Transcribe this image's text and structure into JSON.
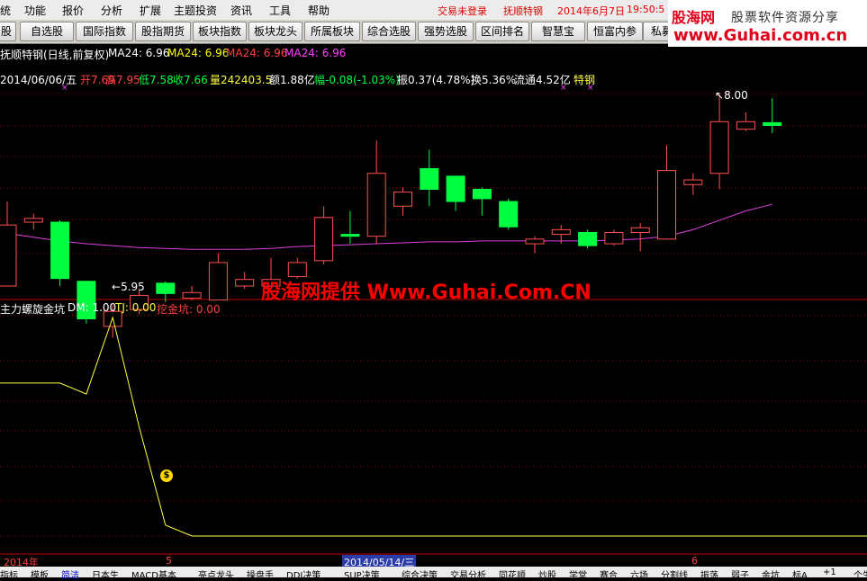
{
  "menu": [
    "统",
    "功能",
    "报价",
    "分析",
    "扩展",
    "主题投资",
    "资讯",
    "工具",
    "帮助"
  ],
  "status": {
    "login": "交易未登录",
    "stock": "抚顺特钢",
    "date": "2014年6月7日",
    "time": "19:50:5"
  },
  "logo": {
    "brand": "股海网",
    "slogan": "股票软件资源分享",
    "url": "www.Guhai.com.cn"
  },
  "toolbar": [
    "股",
    "自选股",
    "国际指数",
    "股指期货",
    "板块指数",
    "板块龙头",
    "所属板块",
    "综合选股",
    "强势选股",
    "区间排名",
    "智慧宝",
    "恒富内参",
    "私募"
  ],
  "chart_header": {
    "title": "抚顺特钢(日线,前复权)",
    "ma_items": [
      {
        "label": "MA24: 6.96",
        "color": "#ffffff"
      },
      {
        "label": "MA24: 6.96",
        "color": "#ffff00"
      },
      {
        "label": "MA24: 6.96",
        "color": "#ff4040"
      },
      {
        "label": "MA24: 6.96",
        "color": "#ff40ff"
      }
    ]
  },
  "info_line": {
    "date": "2014/06/06/五",
    "open": "开7.69",
    "high": "高7.95",
    "low": "低7.58",
    "close": "收7.66",
    "volume": "量242403.5",
    "amount": "额1.88亿",
    "change": "幅-0.08(-1.03%)",
    "amplitude": "振0.37(4.78%)",
    "turnover": "换5.36%",
    "float": "流通4.52亿",
    "sector": "特钢"
  },
  "annotations": {
    "high": "8.00",
    "low": "5.95"
  },
  "watermark": "股海网提供 Www.Guhai.Com.CN",
  "indicator": {
    "name": "主力螺旋金坑",
    "dm": "DM: 1.00",
    "tj": "TJ: 0.00",
    "wjk": "挖金坑: 0.00",
    "marker": "$"
  },
  "time_axis": {
    "start": "2014年",
    "mid": "5",
    "cursor": "2014/05/14/三",
    "end": "6"
  },
  "bottom_tabs": [
    "指标",
    "模板",
    "简洁",
    "日本生",
    "MACD基本",
    "亮点龙头",
    "操盘手",
    "DDI决策",
    "SUP决策",
    "综合决策",
    "交易分析",
    "同花顺",
    "炒股",
    "学堂",
    "赛合",
    "六场",
    "分割线",
    "振荡",
    "弱子",
    "金坑",
    "标A",
    "+1",
    "个生"
  ],
  "colors": {
    "up": "#ff5050",
    "down": "#00ff40",
    "ma": "#e040e0",
    "indicator": "#ffff40",
    "grid": "#8b0000"
  },
  "chart_data": {
    "type": "candlestick",
    "candles": [
      {
        "o": 5.95,
        "c": 6.6,
        "h": 6.85,
        "l": 5.95
      },
      {
        "o": 6.63,
        "c": 6.67,
        "h": 6.72,
        "l": 6.55
      },
      {
        "o": 6.63,
        "c": 6.03,
        "h": 6.65,
        "l": 5.95
      },
      {
        "o": 6.0,
        "c": 5.6,
        "h": 6.0,
        "l": 5.55
      },
      {
        "o": 5.52,
        "c": 5.68,
        "h": 5.75,
        "l": 5.4
      },
      {
        "o": 5.7,
        "c": 5.85,
        "h": 5.9,
        "l": 5.65
      },
      {
        "o": 5.98,
        "c": 5.87,
        "h": 6.0,
        "l": 5.78
      },
      {
        "o": 5.82,
        "c": 5.88,
        "h": 5.95,
        "l": 5.8
      },
      {
        "o": 5.8,
        "c": 6.2,
        "h": 6.3,
        "l": 5.8
      },
      {
        "o": 5.95,
        "c": 6.02,
        "h": 6.1,
        "l": 5.92
      },
      {
        "o": 5.95,
        "c": 6.02,
        "h": 6.25,
        "l": 5.92
      },
      {
        "o": 6.05,
        "c": 6.2,
        "h": 6.25,
        "l": 6.03
      },
      {
        "o": 6.22,
        "c": 6.68,
        "h": 6.8,
        "l": 6.18
      },
      {
        "o": 6.5,
        "c": 6.48,
        "h": 6.75,
        "l": 6.4
      },
      {
        "o": 6.48,
        "c": 7.15,
        "h": 7.5,
        "l": 6.4
      },
      {
        "o": 6.8,
        "c": 6.95,
        "h": 7.0,
        "l": 6.7
      },
      {
        "o": 7.2,
        "c": 6.98,
        "h": 7.4,
        "l": 6.8
      },
      {
        "o": 7.12,
        "c": 6.85,
        "h": 7.12,
        "l": 6.75
      },
      {
        "o": 6.98,
        "c": 6.88,
        "h": 7.0,
        "l": 6.7
      },
      {
        "o": 6.85,
        "c": 6.58,
        "h": 6.88,
        "l": 6.55
      },
      {
        "o": 6.4,
        "c": 6.45,
        "h": 6.48,
        "l": 6.3
      },
      {
        "o": 6.5,
        "c": 6.55,
        "h": 6.6,
        "l": 6.4
      },
      {
        "o": 6.52,
        "c": 6.38,
        "h": 6.55,
        "l": 6.35
      },
      {
        "o": 6.4,
        "c": 6.52,
        "h": 6.55,
        "l": 6.38
      },
      {
        "o": 6.52,
        "c": 6.57,
        "h": 6.62,
        "l": 6.32
      },
      {
        "o": 6.45,
        "c": 7.18,
        "h": 7.45,
        "l": 6.45
      },
      {
        "o": 7.03,
        "c": 7.08,
        "h": 7.15,
        "l": 6.92
      },
      {
        "o": 7.15,
        "c": 7.7,
        "h": 8.0,
        "l": 6.98
      },
      {
        "o": 7.62,
        "c": 7.7,
        "h": 7.8,
        "l": 7.6
      },
      {
        "o": 7.69,
        "c": 7.66,
        "h": 7.95,
        "l": 7.58
      }
    ],
    "ma": [
      6.51,
      6.47,
      6.43,
      6.4,
      6.38,
      6.36,
      6.35,
      6.34,
      6.34,
      6.34,
      6.35,
      6.37,
      6.38,
      6.39,
      6.4,
      6.41,
      6.42,
      6.42,
      6.43,
      6.43,
      6.43,
      6.43,
      6.43,
      6.44,
      6.45,
      6.48,
      6.55,
      6.65,
      6.75,
      6.82
    ],
    "indicator_dm": [
      0.7,
      0.7,
      0.7,
      0.65,
      1.0,
      0.5,
      0.05,
      0.0,
      0.0,
      0.0,
      0.0,
      0.0,
      0.0,
      0.0,
      0.0,
      0.0,
      0.0,
      0.0,
      0.0,
      0.0,
      0.0,
      0.0,
      0.0,
      0.0,
      0.0,
      0.0,
      0.0,
      0.0,
      0.0,
      0.0
    ]
  }
}
